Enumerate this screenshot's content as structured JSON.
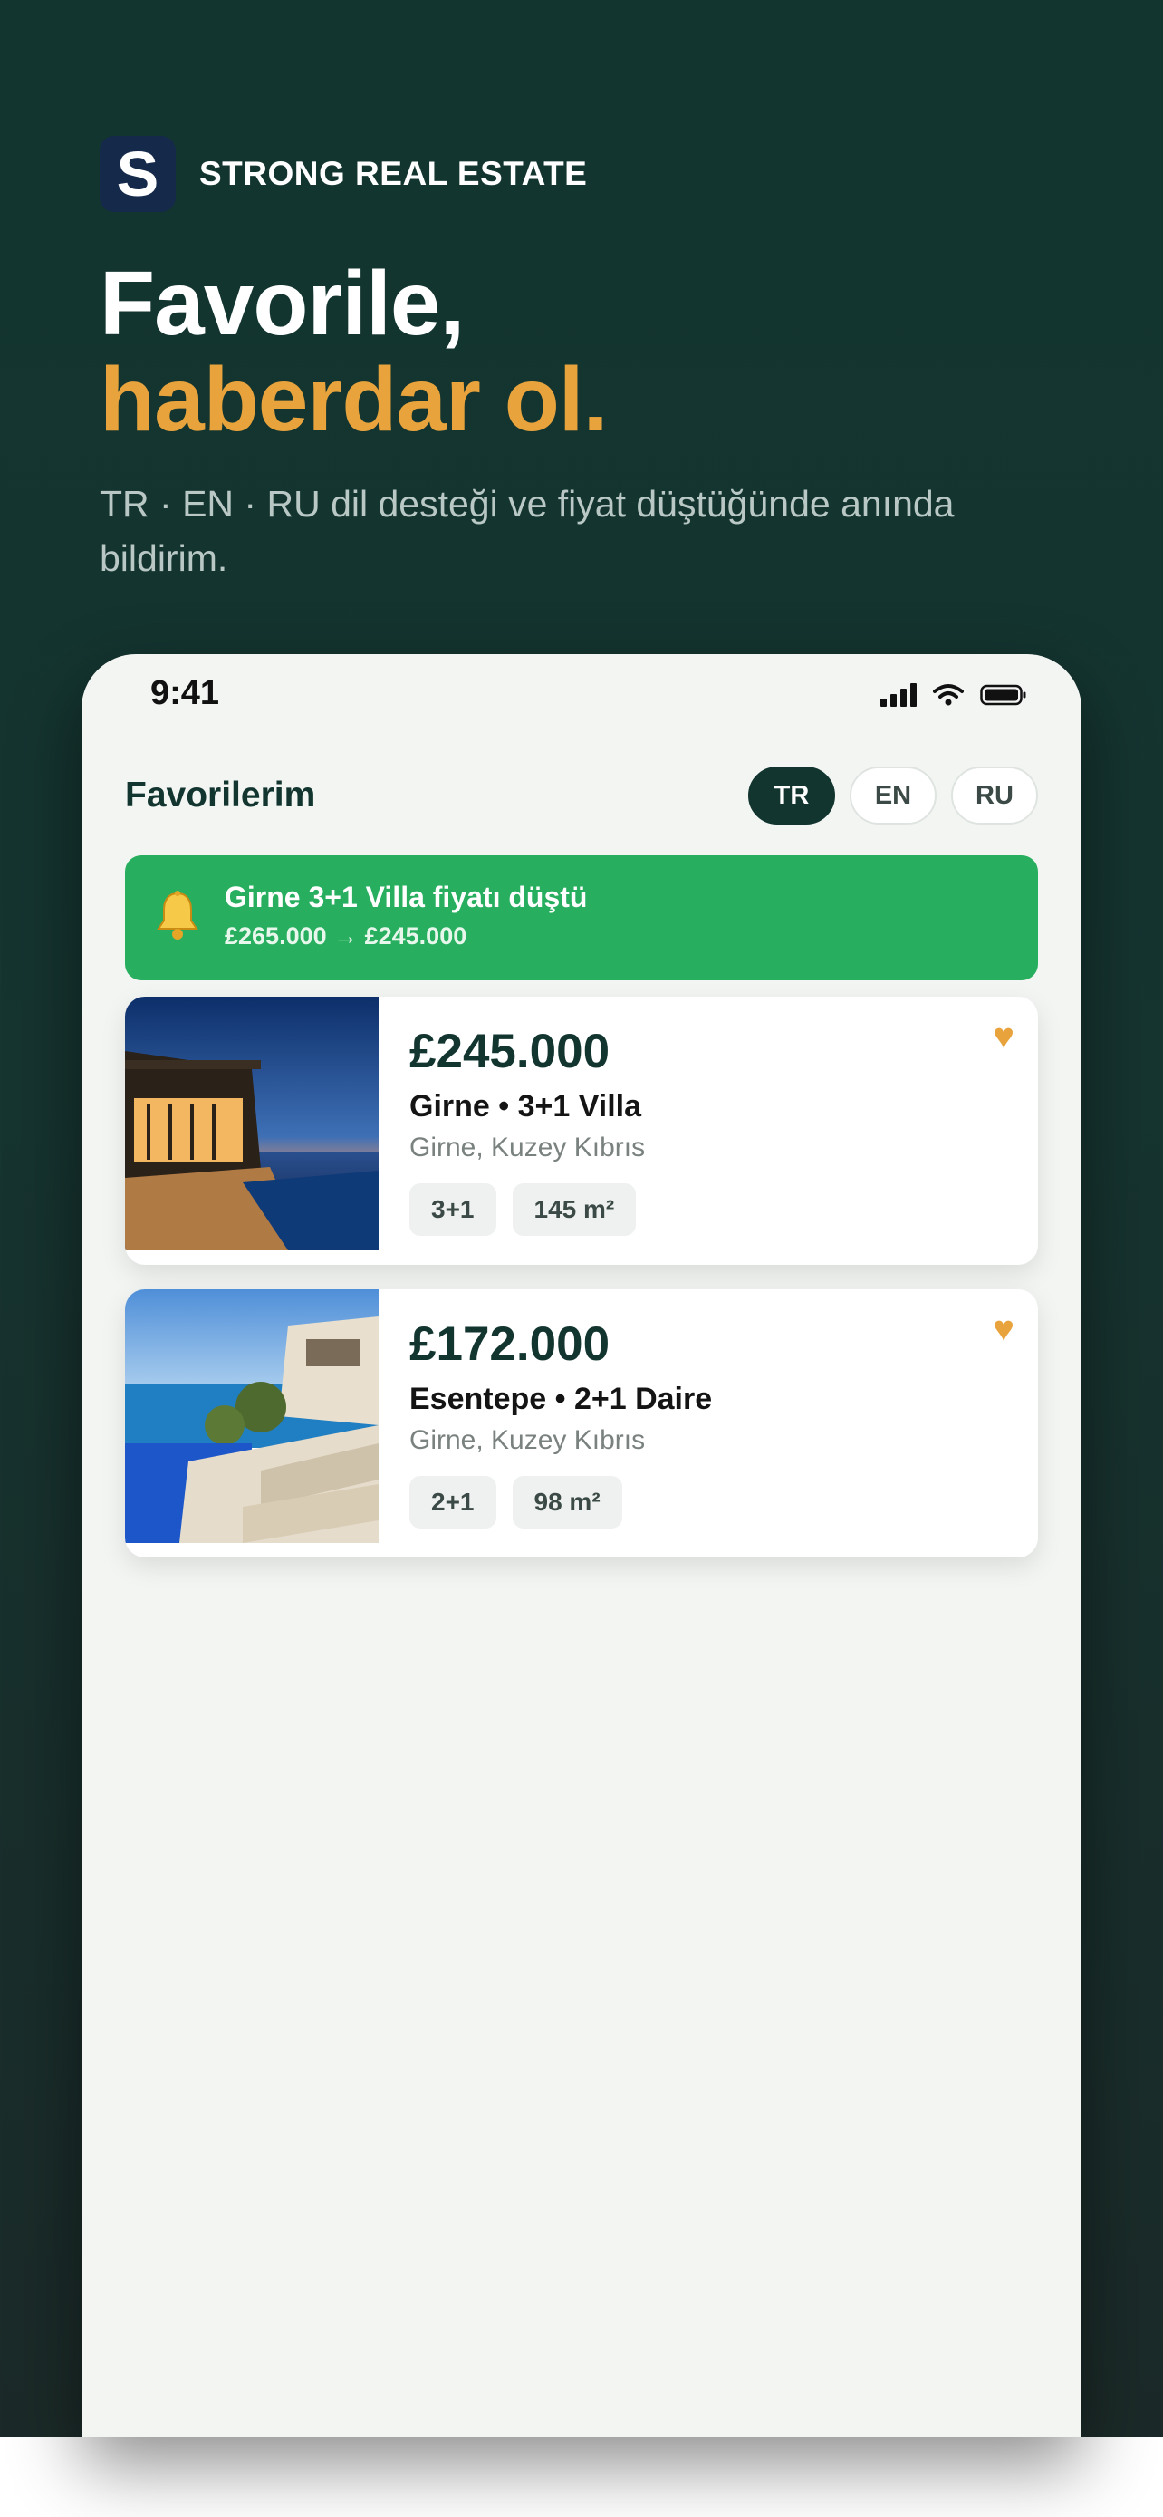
{
  "brand": {
    "logo_letter": "S",
    "name": "STRONG REAL ESTATE"
  },
  "hero": {
    "title_line1": "Favorile,",
    "title_line2": "haberdar ol.",
    "subtitle": "TR · EN · RU dil desteği ve fiyat düştüğünde anında bildirim."
  },
  "phone": {
    "status_bar": {
      "time": "9:41",
      "icons": [
        "signal-icon",
        "wifi-icon",
        "battery-icon"
      ]
    },
    "header": {
      "title": "Favorilerim",
      "languages": [
        {
          "label": "TR",
          "active": true
        },
        {
          "label": "EN",
          "active": false
        },
        {
          "label": "RU",
          "active": false
        }
      ]
    },
    "notification": {
      "icon": "bell-icon",
      "title": "Girne 3+1 Villa fiyatı düştü",
      "price_change": "£265.000 → £245.000"
    },
    "listings": [
      {
        "price": "£245.000",
        "title": "Girne • 3+1 Villa",
        "location": "Girne, Kuzey Kıbrıs",
        "tags": [
          "3+1",
          "145 m²"
        ],
        "favorite_icon": "heart-icon"
      },
      {
        "price": "£172.000",
        "title": "Esentepe • 2+1 Daire",
        "location": "Girne, Kuzey Kıbrıs",
        "tags": [
          "2+1",
          "98 m²"
        ],
        "favorite_icon": "heart-icon"
      }
    ]
  },
  "colors": {
    "background": "#12352f",
    "accent": "#e8a33c",
    "notification": "#27af5f",
    "logo": "#15294a"
  }
}
